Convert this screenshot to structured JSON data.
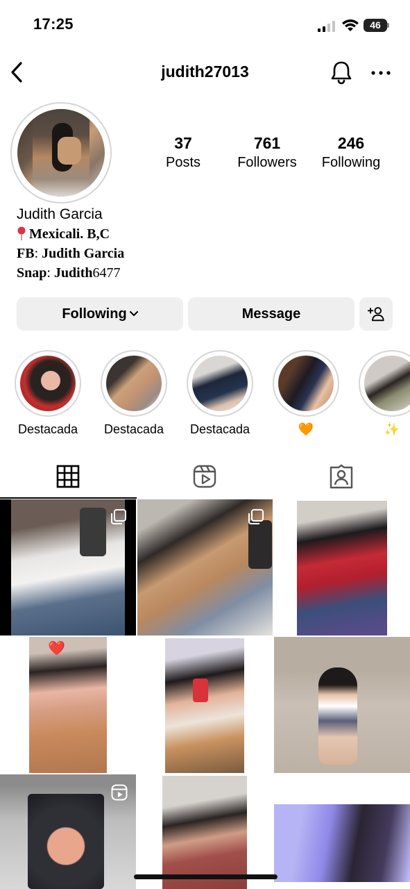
{
  "status_bar": {
    "time": "17:25",
    "battery": "46"
  },
  "nav": {
    "username": "judith27013"
  },
  "profile": {
    "stats": [
      {
        "value": "37",
        "label": "Posts"
      },
      {
        "value": "761",
        "label": "Followers"
      },
      {
        "value": "246",
        "label": "Following"
      }
    ],
    "full_name": "Judith Garcia",
    "bio": {
      "location": "Mexicali. B,C",
      "fb_label": "FB",
      "fb_value": "Judith Garcia",
      "snap_label": "Snap",
      "snap_name": "Judith",
      "snap_digits": "6477"
    }
  },
  "actions": {
    "following": "Following",
    "message": "Message"
  },
  "highlights": [
    {
      "label": "Destacada"
    },
    {
      "label": "Destacada"
    },
    {
      "label": "Destacada"
    },
    {
      "label": "🧡"
    },
    {
      "label": "✨"
    }
  ],
  "tabs": [
    "grid-icon",
    "reels-icon",
    "tagged-icon"
  ],
  "grid": [
    {
      "badge": "multi-photo-icon"
    },
    {
      "badge": "multi-photo-icon"
    },
    {
      "badge": ""
    },
    {
      "badge": "heart-emoji"
    },
    {
      "badge": ""
    },
    {
      "badge": ""
    },
    {
      "badge": "reel-icon"
    },
    {
      "badge": ""
    },
    {
      "badge": ""
    }
  ],
  "colors": {
    "button_bg": "#efefef",
    "ring": "#d6d6d6",
    "text": "#000000"
  }
}
